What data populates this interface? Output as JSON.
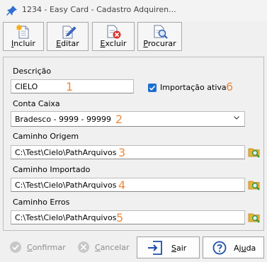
{
  "window": {
    "title": "1234 - Easy Card - Cadastro Adquiren..."
  },
  "toolbar": {
    "incluir": {
      "pre": "",
      "accel": "I",
      "post": "ncluir"
    },
    "editar": {
      "pre": "",
      "accel": "E",
      "post": "ditar"
    },
    "excluir": {
      "pre": "",
      "accel": "E",
      "post": "xcluir"
    },
    "procurar": {
      "pre": "",
      "accel": "P",
      "post": "rocurar"
    }
  },
  "form": {
    "descricao": {
      "label": "Descrição",
      "value": "CIELO",
      "number": "1"
    },
    "importacao": {
      "label": "Importação ativa",
      "checked": true,
      "number": "6"
    },
    "conta_caixa": {
      "label": "Conta Caixa",
      "value": "Bradesco -  9999 - 99999",
      "number": "2"
    },
    "caminho_origem": {
      "label": "Caminho Origem",
      "value": "C:\\Test\\Cielo\\PathArquivos",
      "number": "3"
    },
    "caminho_importado": {
      "label": "Caminho Importado",
      "value": "C:\\Test\\Cielo\\PathArquivos",
      "number": "4"
    },
    "caminho_erros": {
      "label": "Caminho Erros",
      "value": "C:\\Test\\Cielo\\PathArquivos",
      "number": "5"
    }
  },
  "buttons": {
    "confirmar": {
      "pre": "",
      "accel": "C",
      "post": "onfirmar",
      "enabled": false
    },
    "cancelar": {
      "pre": "",
      "accel": "C",
      "post": "ancelar",
      "enabled": false
    },
    "sair": {
      "pre": "",
      "accel": "S",
      "post": "air",
      "enabled": true
    },
    "ajuda": {
      "pre": "Aj",
      "accel": "u",
      "post": "da",
      "enabled": true
    }
  },
  "colors": {
    "accent": "#1a6fd1",
    "annotation": "#f08a3c",
    "folder": "#e8b23a",
    "delete": "#d9342b"
  }
}
